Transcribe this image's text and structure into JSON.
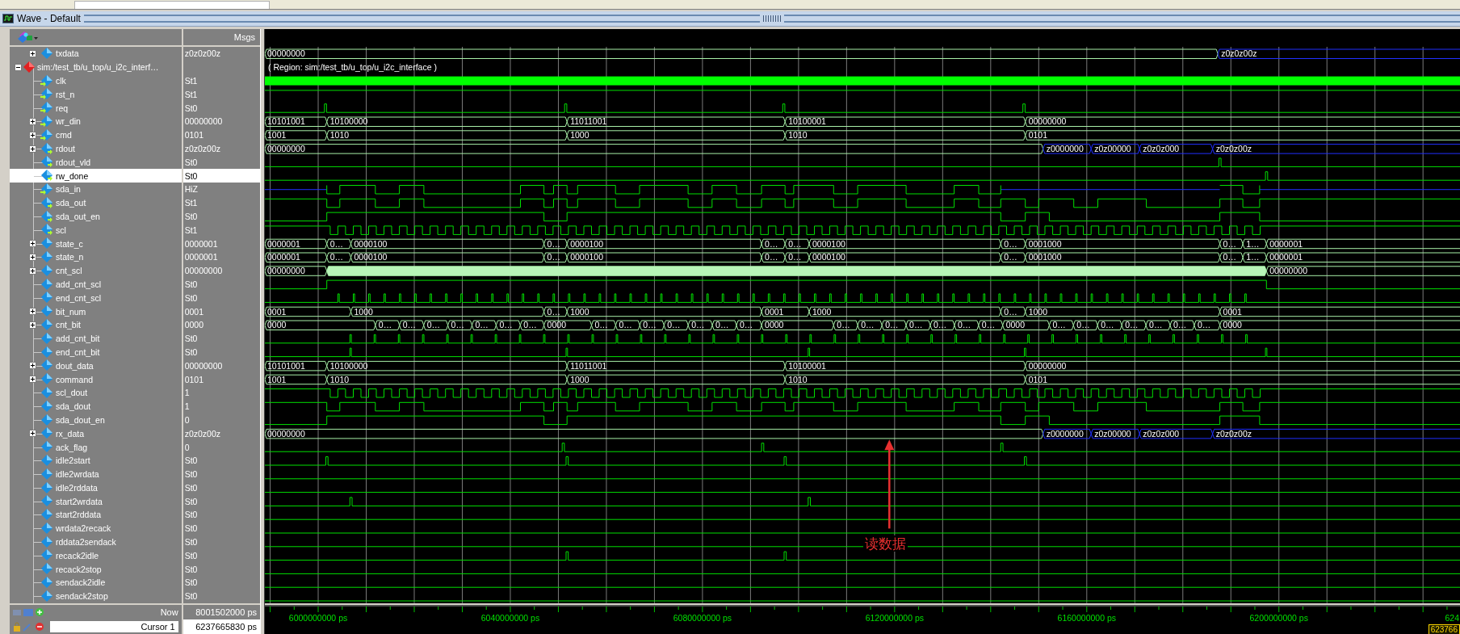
{
  "window": {
    "title": "Wave - Default"
  },
  "header": {
    "values_header": "Msgs"
  },
  "signals": [
    {
      "name": "txdata",
      "kind": "txbus",
      "input": false,
      "output": false,
      "expanded": false,
      "selected": false,
      "value": "z0z0z00z",
      "segments": [
        {
          "label": "00000000",
          "hiz": false
        },
        {
          "label": "z0z0z00z",
          "hiz": true
        }
      ]
    },
    {
      "name": "sim:/test_tb/u_top/u_i2c_interf…",
      "kind": "region",
      "expanded": true,
      "selected": false,
      "region_label": "( Region: sim:/test_tb/u_top/u_i2c_interface )",
      "children": [
        {
          "name": "clk",
          "kind": "clock",
          "input": true,
          "output": false,
          "selected": false,
          "value": "St1"
        },
        {
          "name": "rst_n",
          "kind": "high",
          "input": true,
          "output": false,
          "selected": false,
          "value": "St1"
        },
        {
          "name": "req",
          "kind": "req",
          "input": true,
          "output": false,
          "selected": false,
          "value": "St0"
        },
        {
          "name": "wr_din",
          "kind": "cmdbus",
          "input": true,
          "output": false,
          "expanded": false,
          "selected": false,
          "value": "00000000",
          "segments": [
            {
              "label": "10101001",
              "hiz": false
            },
            {
              "label": "10100000",
              "hiz": false
            },
            {
              "label": "11011001",
              "hiz": false
            },
            {
              "label": "10100001",
              "hiz": false
            },
            {
              "label": "00000000",
              "hiz": false
            }
          ]
        },
        {
          "name": "cmd",
          "kind": "cmdbus",
          "input": true,
          "output": false,
          "expanded": false,
          "selected": false,
          "value": "0101",
          "segments": [
            {
              "label": "1001",
              "hiz": false
            },
            {
              "label": "1010",
              "hiz": false
            },
            {
              "label": "1000",
              "hiz": false
            },
            {
              "label": "1010",
              "hiz": false
            },
            {
              "label": "0101",
              "hiz": false
            }
          ]
        },
        {
          "name": "rdout",
          "kind": "rdbus",
          "input": false,
          "output": true,
          "expanded": false,
          "selected": false,
          "value": "z0z0z00z",
          "segments": [
            {
              "label": "00000000",
              "hiz": false
            },
            {
              "label": "z0000000",
              "hiz": true
            },
            {
              "label": "z0z00000",
              "hiz": true
            },
            {
              "label": "z0z0z000",
              "hiz": true
            },
            {
              "label": "z0z0z00z",
              "hiz": true
            }
          ]
        },
        {
          "name": "rdout_vld",
          "kind": "rdvld",
          "input": false,
          "output": true,
          "selected": false,
          "value": "St0"
        },
        {
          "name": "rw_done",
          "kind": "rwdone",
          "input": false,
          "output": true,
          "selected": true,
          "value": "St0"
        },
        {
          "name": "sda_in",
          "kind": "sdain",
          "input": true,
          "output": false,
          "selected": false,
          "value": "HiZ"
        },
        {
          "name": "sda_out",
          "kind": "sda",
          "input": false,
          "output": true,
          "selected": false,
          "value": "St1"
        },
        {
          "name": "sda_out_en",
          "kind": "sdaen",
          "input": false,
          "output": true,
          "selected": false,
          "value": "St0"
        },
        {
          "name": "scl",
          "kind": "scl",
          "input": false,
          "output": true,
          "selected": false,
          "value": "St1"
        },
        {
          "name": "state_c",
          "kind": "statebus",
          "input": false,
          "output": false,
          "expanded": false,
          "selected": false,
          "value": "0000001",
          "segments": [
            {
              "label": "0000001",
              "hiz": false
            },
            {
              "label": "0…",
              "hiz": false
            },
            {
              "label": "0000100",
              "hiz": false
            },
            {
              "label": "0…",
              "hiz": false
            },
            {
              "label": "0000100",
              "hiz": false
            },
            {
              "label": "0…",
              "hiz": false
            },
            {
              "label": "0…",
              "hiz": false
            },
            {
              "label": "0000100",
              "hiz": false
            },
            {
              "label": "0…",
              "hiz": false
            },
            {
              "label": "0001000",
              "hiz": false
            },
            {
              "label": "0…",
              "hiz": false
            },
            {
              "label": "1…",
              "hiz": false
            },
            {
              "label": "0000001",
              "hiz": false
            }
          ]
        },
        {
          "name": "state_n",
          "kind": "statebus",
          "input": false,
          "output": false,
          "expanded": false,
          "selected": false,
          "value": "0000001",
          "segments": [
            {
              "label": "0000001",
              "hiz": false
            },
            {
              "label": "0…",
              "hiz": false
            },
            {
              "label": "0000100",
              "hiz": false
            },
            {
              "label": "0…",
              "hiz": false
            },
            {
              "label": "0000100",
              "hiz": false
            },
            {
              "label": "0…",
              "hiz": false
            },
            {
              "label": "0…",
              "hiz": false
            },
            {
              "label": "0000100",
              "hiz": false
            },
            {
              "label": "0…",
              "hiz": false
            },
            {
              "label": "0001000",
              "hiz": false
            },
            {
              "label": "0…",
              "hiz": false
            },
            {
              "label": "1…",
              "hiz": false
            },
            {
              "label": "0000001",
              "hiz": false
            }
          ]
        },
        {
          "name": "cnt_scl",
          "kind": "densebus",
          "input": false,
          "output": false,
          "expanded": false,
          "selected": false,
          "value": "00000000",
          "segments": [
            {
              "label": "00000000",
              "hiz": false
            },
            {
              "dense": true,
              "hiz": false
            },
            {
              "label": "00000000",
              "hiz": false
            }
          ]
        },
        {
          "name": "add_cnt_scl",
          "kind": "run",
          "input": false,
          "output": false,
          "selected": false,
          "value": "St0"
        },
        {
          "name": "end_cnt_scl",
          "kind": "scltick",
          "input": false,
          "output": false,
          "selected": false,
          "value": "St0"
        },
        {
          "name": "bit_num",
          "kind": "bitnumbus",
          "input": false,
          "output": false,
          "expanded": false,
          "selected": false,
          "value": "0001",
          "segments": [
            {
              "label": "0001",
              "hiz": false
            },
            {
              "label": "1000",
              "hiz": false
            },
            {
              "label": "0…",
              "hiz": false
            },
            {
              "label": "1000",
              "hiz": false
            },
            {
              "label": "0001",
              "hiz": false
            },
            {
              "label": "1000",
              "hiz": false
            },
            {
              "label": "0…",
              "hiz": false
            },
            {
              "label": "1000",
              "hiz": false
            },
            {
              "label": "0001",
              "hiz": false
            }
          ]
        },
        {
          "name": "cnt_bit",
          "kind": "cntbus",
          "input": false,
          "output": false,
          "expanded": false,
          "selected": false,
          "value": "0000",
          "segments": [
            {
              "label": "0000",
              "hiz": false
            },
            {
              "label": "0…",
              "hiz": false
            },
            {
              "label": "0…",
              "hiz": false
            },
            {
              "label": "0…",
              "hiz": false
            },
            {
              "label": "0…",
              "hiz": false
            },
            {
              "label": "0…",
              "hiz": false
            },
            {
              "label": "0…",
              "hiz": false
            },
            {
              "label": "0…",
              "hiz": false
            },
            {
              "label": "0000",
              "hiz": false
            },
            {
              "label": "0…",
              "hiz": false
            },
            {
              "label": "0…",
              "hiz": false
            },
            {
              "label": "0…",
              "hiz": false
            },
            {
              "label": "0…",
              "hiz": false
            },
            {
              "label": "0…",
              "hiz": false
            },
            {
              "label": "0…",
              "hiz": false
            },
            {
              "label": "0…",
              "hiz": false
            },
            {
              "label": "0000",
              "hiz": false
            },
            {
              "label": "0…",
              "hiz": false
            },
            {
              "label": "0…",
              "hiz": false
            },
            {
              "label": "0…",
              "hiz": false
            },
            {
              "label": "0…",
              "hiz": false
            },
            {
              "label": "0…",
              "hiz": false
            },
            {
              "label": "0…",
              "hiz": false
            },
            {
              "label": "0…",
              "hiz": false
            },
            {
              "label": "0000",
              "hiz": false
            },
            {
              "label": "0…",
              "hiz": false
            },
            {
              "label": "0…",
              "hiz": false
            },
            {
              "label": "0…",
              "hiz": false
            },
            {
              "label": "0…",
              "hiz": false
            },
            {
              "label": "0…",
              "hiz": false
            },
            {
              "label": "0…",
              "hiz": false
            },
            {
              "label": "0…",
              "hiz": false
            },
            {
              "label": "0000",
              "hiz": false
            }
          ]
        },
        {
          "name": "add_cnt_bit",
          "kind": "bittick",
          "input": false,
          "output": false,
          "selected": false,
          "value": "St0"
        },
        {
          "name": "end_cnt_bit",
          "kind": "byteend",
          "input": false,
          "output": false,
          "selected": false,
          "value": "St0"
        },
        {
          "name": "dout_data",
          "kind": "cmdbus",
          "input": false,
          "output": false,
          "expanded": false,
          "selected": false,
          "value": "00000000",
          "segments": [
            {
              "label": "10101001",
              "hiz": false
            },
            {
              "label": "10100000",
              "hiz": false
            },
            {
              "label": "11011001",
              "hiz": false
            },
            {
              "label": "10100001",
              "hiz": false
            },
            {
              "label": "00000000",
              "hiz": false
            }
          ]
        },
        {
          "name": "command",
          "kind": "cmdbus",
          "input": false,
          "output": false,
          "expanded": false,
          "selected": false,
          "value": "0101",
          "segments": [
            {
              "label": "1001",
              "hiz": false
            },
            {
              "label": "1010",
              "hiz": false
            },
            {
              "label": "1000",
              "hiz": false
            },
            {
              "label": "1010",
              "hiz": false
            },
            {
              "label": "0101",
              "hiz": false
            }
          ]
        },
        {
          "name": "scl_dout",
          "kind": "scl",
          "input": false,
          "output": false,
          "selected": false,
          "value": "1"
        },
        {
          "name": "sda_dout",
          "kind": "sda",
          "input": false,
          "output": false,
          "selected": false,
          "value": "1"
        },
        {
          "name": "sda_dout_en",
          "kind": "sdaen",
          "input": false,
          "output": false,
          "selected": false,
          "value": "0"
        },
        {
          "name": "rx_data",
          "kind": "rdbus",
          "input": false,
          "output": false,
          "expanded": false,
          "selected": false,
          "value": "z0z0z00z",
          "segments": [
            {
              "label": "00000000",
              "hiz": false
            },
            {
              "label": "z0000000",
              "hiz": true
            },
            {
              "label": "z0z00000",
              "hiz": true
            },
            {
              "label": "z0z0z000",
              "hiz": true
            },
            {
              "label": "z0z0z00z",
              "hiz": true
            }
          ]
        },
        {
          "name": "ack_flag",
          "kind": "ack",
          "input": false,
          "output": false,
          "selected": false,
          "value": "0"
        },
        {
          "name": "idle2start",
          "kind": "start",
          "input": false,
          "output": false,
          "selected": false,
          "value": "St0"
        },
        {
          "name": "idle2wrdata",
          "kind": "low",
          "input": false,
          "output": false,
          "selected": false,
          "value": "St0"
        },
        {
          "name": "idle2rddata",
          "kind": "low",
          "input": false,
          "output": false,
          "selected": false,
          "value": "St0"
        },
        {
          "name": "start2wrdata",
          "kind": "wrstart",
          "input": false,
          "output": false,
          "selected": false,
          "value": "St0"
        },
        {
          "name": "start2rddata",
          "kind": "low",
          "input": false,
          "output": false,
          "selected": false,
          "value": "St0"
        },
        {
          "name": "wrdata2recack",
          "kind": "low",
          "input": false,
          "output": false,
          "selected": false,
          "value": "St0"
        },
        {
          "name": "rddata2sendack",
          "kind": "low",
          "input": false,
          "output": false,
          "selected": false,
          "value": "St0"
        },
        {
          "name": "recack2idle",
          "kind": "recidle",
          "input": false,
          "output": false,
          "selected": false,
          "value": "St0"
        },
        {
          "name": "recack2stop",
          "kind": "low",
          "input": false,
          "output": false,
          "selected": false,
          "value": "St0"
        },
        {
          "name": "sendack2idle",
          "kind": "low",
          "input": false,
          "output": false,
          "selected": false,
          "value": "St0"
        },
        {
          "name": "sendack2stop",
          "kind": "low",
          "input": false,
          "output": false,
          "selected": false,
          "value": "St0"
        }
      ]
    }
  ],
  "annotation": {
    "text": "读数据"
  },
  "timeline": {
    "ticks": [
      {
        "label": "6000000000 ps",
        "cut": false
      },
      {
        "label": "6040000000 ps",
        "cut": false
      },
      {
        "label": "6080000000 ps",
        "cut": false
      },
      {
        "label": "6120000000 ps",
        "cut": false
      },
      {
        "label": "6160000000 ps",
        "cut": false
      },
      {
        "label": "6200000000 ps",
        "cut": false
      },
      {
        "label": "624",
        "cut": true
      }
    ]
  },
  "now": {
    "label": "Now",
    "time": "8001502000 ps"
  },
  "cursor": {
    "label": "Cursor 1",
    "time": "6237665830 ps",
    "flag": "623766"
  }
}
